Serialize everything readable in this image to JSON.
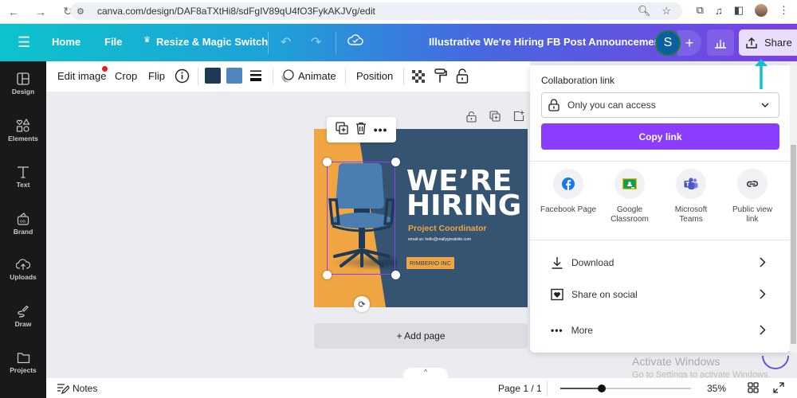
{
  "browser": {
    "url": "canva.com/design/DAF8aTXtHi8/sdFgIV89qU4fO3FykAKJVg/edit"
  },
  "topbar": {
    "home": "Home",
    "file": "File",
    "resize": "Resize & Magic Switch",
    "title": "Illustrative We're Hiring FB Post Announcement",
    "avatar_initial": "S",
    "share": "Share",
    "gradient_start": "#0dc3cc",
    "gradient_end": "#7b3fe4"
  },
  "sidebar": {
    "items": [
      {
        "label": "Design",
        "icon": "layout-icon"
      },
      {
        "label": "Elements",
        "icon": "shapes-icon"
      },
      {
        "label": "Text",
        "icon": "text-icon"
      },
      {
        "label": "Brand",
        "icon": "brand-icon"
      },
      {
        "label": "Uploads",
        "icon": "cloud-upload-icon"
      },
      {
        "label": "Draw",
        "icon": "pen-icon"
      },
      {
        "label": "Projects",
        "icon": "folder-icon"
      }
    ]
  },
  "toolbar": {
    "edit_image": "Edit image",
    "crop": "Crop",
    "flip": "Flip",
    "animate": "Animate",
    "position": "Position",
    "color1": "#1f3a56",
    "color2": "#4e86bf"
  },
  "design": {
    "headline_1": "WE’RE",
    "headline_2": "HIRING",
    "role": "Project Coordinator",
    "email": "email us: hello@reallygreatsite.com",
    "company": "RIMBERIO INC",
    "bg_color": "#345472",
    "accent_color": "#efa542"
  },
  "canvas": {
    "add_page": "+ Add page"
  },
  "share_panel": {
    "collab_label": "Collaboration link",
    "access_value": "Only you can access",
    "copy_link": "Copy link",
    "targets": [
      {
        "label": "Facebook Page",
        "icon": "facebook-icon"
      },
      {
        "label": "Google Classroom",
        "icon": "google-classroom-icon"
      },
      {
        "label": "Microsoft Teams",
        "icon": "teams-icon"
      },
      {
        "label": "Public view link",
        "icon": "link-icon"
      }
    ],
    "menu": [
      {
        "label": "Download",
        "icon": "download-icon"
      },
      {
        "label": "Share on social",
        "icon": "heart-icon"
      },
      {
        "label": "More",
        "icon": "more-icon"
      }
    ],
    "button_color": "#8b3dff"
  },
  "bottombar": {
    "notes": "Notes",
    "page": "Page 1 / 1",
    "zoom": "35%",
    "zoom_fraction": 0.32
  },
  "watermark": {
    "line1": "Activate Windows",
    "line2": "Go to Settings to activate Windows."
  }
}
